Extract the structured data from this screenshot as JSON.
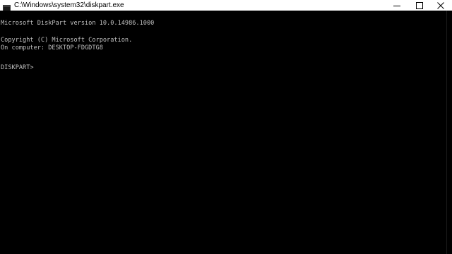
{
  "window": {
    "title": "C:\\Windows\\system32\\diskpart.exe",
    "app_icon": "console-app-icon",
    "buttons": {
      "minimize_icon": "minimize-icon",
      "maximize_icon": "maximize-icon",
      "close_icon": "close-icon"
    }
  },
  "console": {
    "lines": [
      "Microsoft DiskPart version 10.0.14986.1000",
      "Copyright (C) Microsoft Corporation.",
      "On computer: DESKTOP-FDGDTG8",
      "DISKPART>"
    ],
    "input_value": ""
  },
  "colors": {
    "background": "#000000",
    "text": "#c0c0c0",
    "titlebar": "#ffffff"
  }
}
